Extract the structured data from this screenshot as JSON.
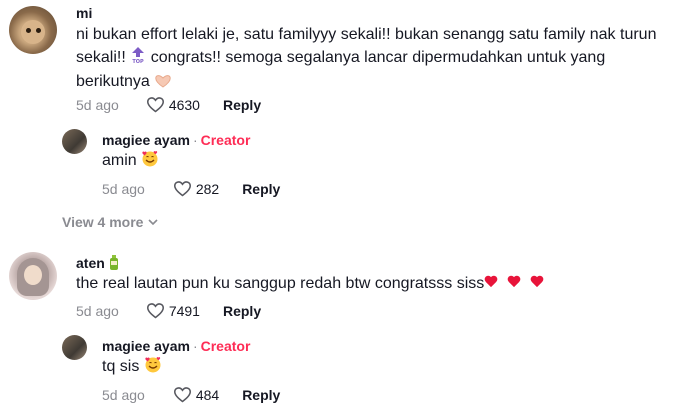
{
  "comments": [
    {
      "username": "mi",
      "text_part1": "ni bukan effort lelaki je, satu familyyy sekali!! bukan senangg satu family nak turun sekali!!",
      "text_part2": "congrats!! semoga segalanya lancar dipermudahkan untuk yang berikutnya",
      "date": "5d ago",
      "likes": "4630",
      "reply_label": "Reply",
      "emoji_top": "top-arrow-emoji",
      "emoji_end": "heart-hands-emoji"
    },
    {
      "username": "magiee ayam",
      "separator": "·",
      "creator_label": "Creator",
      "text": "amin",
      "date": "5d ago",
      "likes": "282",
      "reply_label": "Reply",
      "emoji_end": "smiling-face-with-hearts-emoji"
    },
    {
      "username": "aten",
      "username_badge": "bottle-emoji",
      "text": "the real lautan pun ku sanggup redah btw congratsss siss",
      "date": "5d ago",
      "likes": "7491",
      "reply_label": "Reply",
      "emoji_end": "red-hearts-emoji"
    },
    {
      "username": "magiee ayam",
      "separator": "·",
      "creator_label": "Creator",
      "text": "tq sis",
      "date": "5d ago",
      "likes": "484",
      "reply_label": "Reply",
      "emoji_end": "smiling-face-with-hearts-emoji"
    }
  ],
  "view_more": "View 4 more",
  "colors": {
    "creator": "#fe2c55",
    "muted": "#8a8b91",
    "text": "#161823"
  }
}
